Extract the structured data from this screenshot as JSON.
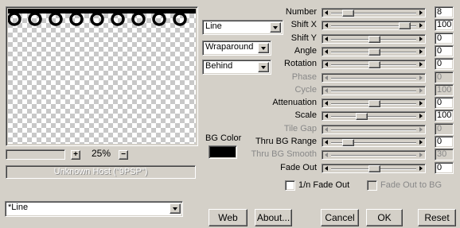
{
  "preview": {
    "zoom_level": "25%",
    "zoom_in": "+",
    "zoom_out": "−"
  },
  "host_label": "Unknown Host (\"9PSP\")",
  "dropdowns": {
    "shape": "Line",
    "edge": "Wraparound",
    "layer": "Behind",
    "preset": "*Line"
  },
  "bg_color": {
    "label": "BG Color",
    "value": "#000000"
  },
  "params": [
    {
      "label": "Number",
      "value": "8",
      "disabled": false,
      "level": 0.15
    },
    {
      "label": "Shift X",
      "value": "100",
      "disabled": false,
      "level": 0.9
    },
    {
      "label": "Shift Y",
      "value": "0",
      "disabled": false,
      "level": 0.5
    },
    {
      "label": "Angle",
      "value": "0",
      "disabled": false,
      "level": 0.5
    },
    {
      "label": "Rotation",
      "value": "0",
      "disabled": false,
      "level": 0.5
    },
    {
      "label": "Phase",
      "value": "0",
      "disabled": true,
      "level": null
    },
    {
      "label": "Cycle",
      "value": "100",
      "disabled": true,
      "level": null
    },
    {
      "label": "Attenuation",
      "value": "0",
      "disabled": false,
      "level": 0.5
    },
    {
      "label": "Scale",
      "value": "100",
      "disabled": false,
      "level": 0.33
    },
    {
      "label": "Tile Gap",
      "value": "0",
      "disabled": true,
      "level": null
    },
    {
      "label": "Thru BG Range",
      "value": "0",
      "disabled": false,
      "level": 0.15
    },
    {
      "label": "Thru BG Smooth",
      "value": "30",
      "disabled": true,
      "level": null
    },
    {
      "label": "Fade Out",
      "value": "0",
      "disabled": false,
      "level": 0.5
    }
  ],
  "checkboxes": {
    "fade_1n": {
      "label": "1/n Fade Out",
      "checked": false,
      "disabled": false
    },
    "fade_bg": {
      "label": "Fade Out to BG",
      "checked": false,
      "disabled": true
    }
  },
  "buttons": {
    "web": "Web",
    "about": "About...",
    "cancel": "Cancel",
    "ok": "OK",
    "reset": "Reset"
  }
}
